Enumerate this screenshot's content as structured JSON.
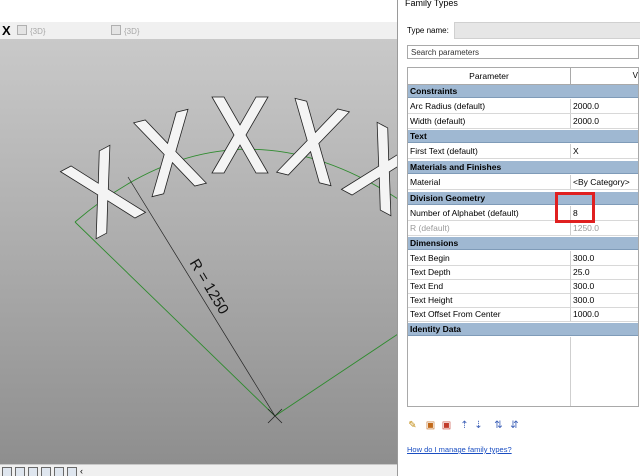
{
  "viewport": {
    "tabs": [
      {
        "label": "{3D}"
      },
      {
        "label": "{3D}"
      }
    ],
    "close_glyph": "X",
    "dimension_label": "R = 1250"
  },
  "dialog": {
    "title": "Family Types",
    "type_name_label": "Type name:",
    "search_placeholder": "Search parameters",
    "grid": {
      "col_parameter": "Parameter",
      "col_value": "V",
      "groups": [
        {
          "name": "Constraints",
          "rows": [
            {
              "param": "Arc Radius (default)",
              "value": "2000.0"
            },
            {
              "param": "Width (default)",
              "value": "2000.0"
            }
          ]
        },
        {
          "name": "Text",
          "rows": [
            {
              "param": "First Text (default)",
              "value": "X"
            }
          ]
        },
        {
          "name": "Materials and Finishes",
          "rows": [
            {
              "param": "Material",
              "value": "<By Category>"
            }
          ]
        },
        {
          "name": "Division Geometry",
          "rows": [
            {
              "param": "Number of Alphabet (default)",
              "value": "8"
            },
            {
              "param": "R (default)",
              "value": "1250.0"
            }
          ]
        },
        {
          "name": "Dimensions",
          "rows": [
            {
              "param": "Text Begin",
              "value": "300.0"
            },
            {
              "param": "Text Depth",
              "value": "25.0"
            },
            {
              "param": "Text End",
              "value": "300.0"
            },
            {
              "param": "Text Height",
              "value": "300.0"
            },
            {
              "param": "Text Offset From Center",
              "value": "1000.0"
            }
          ]
        },
        {
          "name": "Identity Data",
          "rows": []
        }
      ]
    },
    "toolbar_icons": [
      "pencil-icon",
      "new-type-icon",
      "delete-type-icon",
      "move-up-icon",
      "move-down-icon",
      "sort-ascending-icon",
      "sort-descending-icon"
    ],
    "help_link": "How do I manage family types?"
  },
  "colors": {
    "group_header": "#9fb8d2",
    "highlight_box": "#e02020",
    "link": "#1a4ec2"
  }
}
